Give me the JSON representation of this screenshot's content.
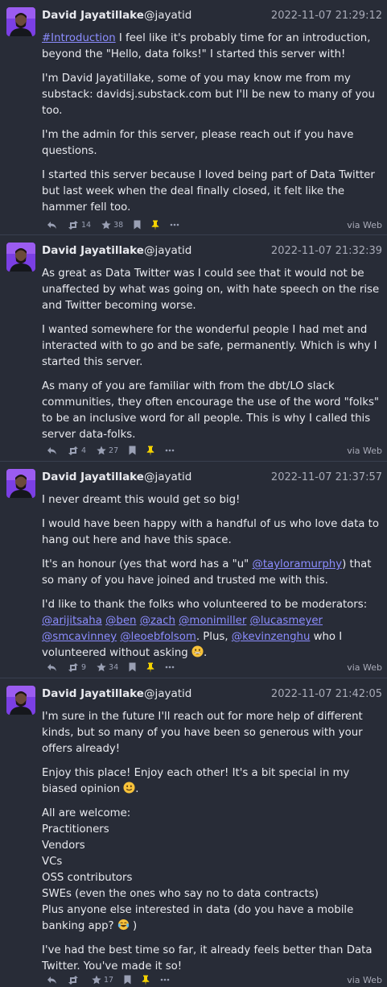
{
  "colors": {
    "background": "#282c37",
    "text": "#e8e9ee",
    "link": "#8c8dff",
    "muted": "#a9abb8",
    "pin": "#f5d300"
  },
  "posts": [
    {
      "author": "David Jayatillake",
      "handle": "@jayatid",
      "timestamp": "2022-11-07 21:29:12",
      "hashtag": "#Introduction",
      "p1_after_tag": " I feel like it's probably time for an introduction, beyond the \"Hello, data folks!\" I started this server with!",
      "p2": "I'm David Jayatillake, some of you may know me from my substack: davidsj.substack.com but I'll be new to many of you too.",
      "p3": "I'm the admin for this server, please reach out if you have questions.",
      "p4": "I started this server because I loved being part of Data Twitter but last week when the deal finally closed, it felt like the hammer fell too.",
      "boosts": "14",
      "favourites": "38",
      "via": "via Web"
    },
    {
      "author": "David Jayatillake",
      "handle": "@jayatid",
      "timestamp": "2022-11-07 21:32:39",
      "p1": "As great as Data Twitter was I could see that it would not be unaffected by what was going on, with hate speech on the rise and Twitter becoming worse.",
      "p2": "I wanted somewhere for the wonderful people I had met and interacted with to go and be safe, permanently. Which is why I started this server.",
      "p3": "As many of you are familiar with from the dbt/LO slack communities, they often encourage the use of the word \"folks\" to be an inclusive word for all people. This is why I called this server data-folks.",
      "boosts": "4",
      "favourites": "27",
      "via": "via Web"
    },
    {
      "author": "David Jayatillake",
      "handle": "@jayatid",
      "timestamp": "2022-11-07 21:37:57",
      "p1": "I never dreamt this would get so big!",
      "p2": "I would have been happy with a handful of us who love data to hang out here and have this space.",
      "p3_before": "It's an honour (yes that word has a \"u\" ",
      "p3_mention": "@tayloramurphy",
      "p3_after": ") that so many of you have joined and trusted me with this.",
      "p4_before": "I'd like to thank the folks who volunteered to be moderators: ",
      "moderators": [
        "@arijitsaha",
        "@ben",
        "@zach",
        "@monimiller",
        "@lucasmeyer",
        "@smcavinney",
        "@leoebfolsom"
      ],
      "p4_plus": ". Plus, ",
      "p4_mention": "@kevinzenghu",
      "p4_after": " who I volunteered without asking ",
      "p4_end": ".",
      "boosts": "9",
      "favourites": "34",
      "via": "via Web"
    },
    {
      "author": "David Jayatillake",
      "handle": "@jayatid",
      "timestamp": "2022-11-07 21:42:05",
      "p1": "I'm sure in the future I'll reach out for more help of different kinds, but so many of you have been so generous with your offers already!",
      "p2_before": "Enjoy this place! Enjoy each other! It's a bit special in my biased opinion ",
      "p2_end": ".",
      "list_lines": [
        "All are welcome:",
        "Practitioners",
        "Vendors",
        "VCs",
        "OSS contributors",
        "SWEs (even the ones who say no to data contracts)"
      ],
      "last_line_before": "Plus anyone else interested in data (do you have a mobile banking app? ",
      "last_line_end": " )",
      "p4": "I've had the best time so far, it already feels better than Data Twitter. You've made it so!",
      "boosts": "",
      "favourites": "17",
      "via": "via Web"
    }
  ]
}
